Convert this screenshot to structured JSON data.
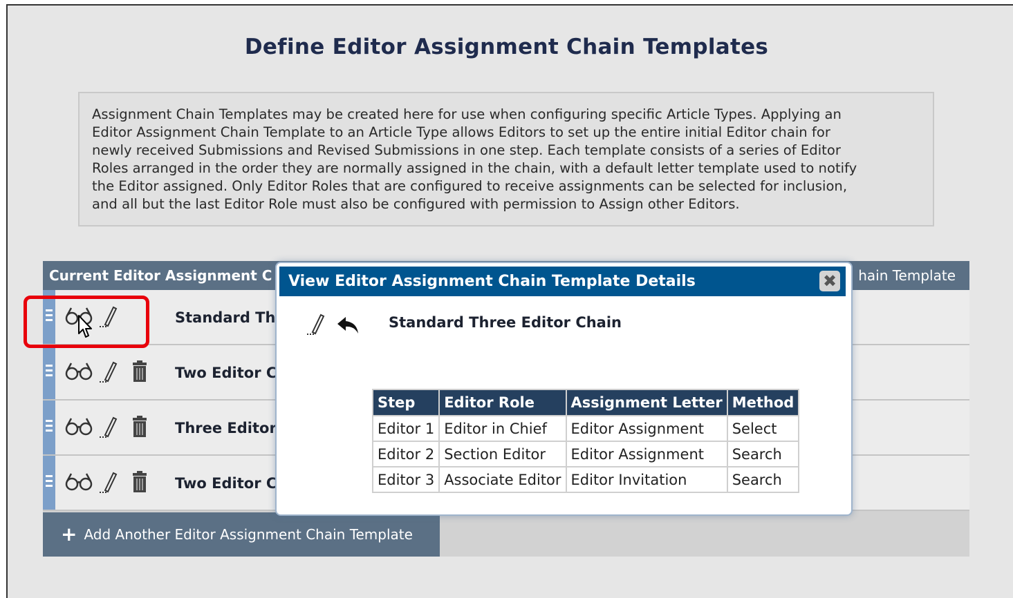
{
  "page": {
    "title": "Define Editor Assignment Chain Templates",
    "description_lines": [
      "Assignment Chain Templates may be created here for use when configuring specific Article Types. Applying an",
      "Editor Assignment Chain Template to an Article Type allows Editors to set up the entire initial Editor chain for",
      "newly received Submissions and Revised Submissions in one step. Each template consists of a series of Editor",
      "Roles arranged in the order they are normally assigned in the chain, with a default letter template used to notify",
      "the Editor assigned. Only Editor Roles that are configured to receive assignments can be selected for inclusion,",
      "and all but the last Editor Role must also be configured with permission to Assign other Editors."
    ]
  },
  "list": {
    "header_left": "Current Editor Assignment C",
    "header_right": "hain Template",
    "rows": [
      {
        "name": "Standard Th",
        "has_delete": false
      },
      {
        "name": "Two Editor C",
        "has_delete": true
      },
      {
        "name": "Three Editor",
        "has_delete": true
      },
      {
        "name": "Two Editor C",
        "has_delete": true
      }
    ],
    "add_label": "Add Another Editor Assignment Chain Template"
  },
  "modal": {
    "title": "View Editor Assignment Chain Template Details",
    "close_glyph": "✖",
    "template_name": "Standard Three Editor Chain",
    "columns": [
      "Step",
      "Editor Role",
      "Assignment Letter",
      "Method"
    ],
    "steps": [
      [
        "Editor 1",
        "Editor in Chief",
        "Editor Assignment",
        "Select"
      ],
      [
        "Editor 2",
        "Section Editor",
        "Editor Assignment",
        "Search"
      ],
      [
        "Editor 3",
        "Associate Editor",
        "Editor Invitation",
        "Search"
      ]
    ]
  },
  "icons": {
    "view": "glasses-icon",
    "edit": "pencil-icon",
    "delete": "trash-icon",
    "back": "undo-arrow-icon",
    "add": "plus-icon"
  },
  "colors": {
    "header_bar": "#5b7085",
    "modal_header": "#00558f",
    "table_header": "#25405f",
    "highlight": "#e8000b",
    "drag_handle": "#7c9fc9"
  }
}
